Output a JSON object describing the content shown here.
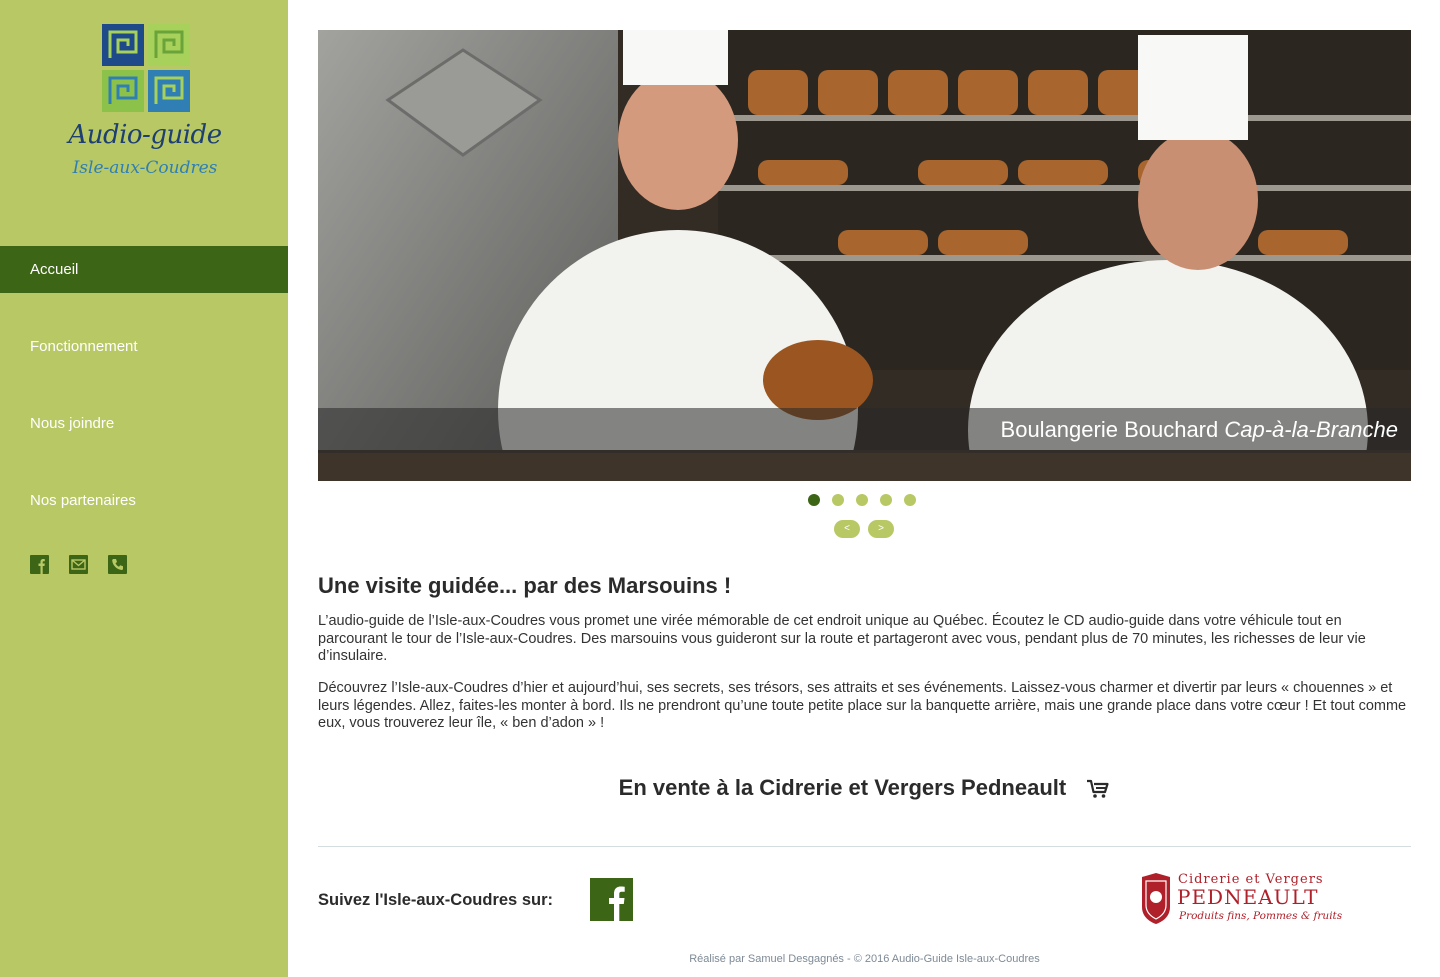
{
  "colors": {
    "sidebar_bg": "#b8c865",
    "nav_active_bg": "#3d6516",
    "accent_dark": "#3d6516",
    "logo_blue": "#1e3f72",
    "logo_light_blue": "#2f7fb5",
    "partner_red": "#b0202a"
  },
  "logo": {
    "title": "Audio-guide",
    "subtitle": "Isle-aux-Coudres"
  },
  "nav": {
    "items": [
      {
        "label": "Accueil",
        "active": true
      },
      {
        "label": "Fonctionnement",
        "active": false
      },
      {
        "label": "Nous joindre",
        "active": false
      },
      {
        "label": "Nos partenaires",
        "active": false
      }
    ]
  },
  "sidebar_social": {
    "icons": [
      "facebook-icon",
      "mail-icon",
      "phone-icon"
    ]
  },
  "slider": {
    "caption_main": "Boulangerie Bouchard ",
    "caption_italic": "Cap-à-la-Branche",
    "slide_count": 5,
    "active_slide": 1,
    "prev_label": "<",
    "next_label": ">"
  },
  "content": {
    "heading": "Une visite guidée... par des Marsouins !",
    "paragraph1": "L’audio-guide de l’Isle-aux-Coudres vous promet une virée mémorable de cet endroit unique au Québec. Écoutez le CD audio-guide dans votre véhicule tout en parcourant le tour de l’Isle-aux-Coudres. Des marsouins vous guideront sur la route et partageront avec vous, pendant plus de 70 minutes, les richesses de leur vie d’insulaire.",
    "paragraph2": "Découvrez l’Isle-aux-Coudres d’hier et aujourd’hui, ses secrets, ses trésors, ses attraits et ses événements. Laissez-vous charmer et divertir par leurs « chouennes » et leurs légendes. Allez, faites-les monter à bord. Ils ne prendront qu’une toute petite place sur la banquette arrière, mais une grande place dans votre cœur ! Et tout comme eux, vous trouverez leur île, « ben d’adon » !",
    "sale_text": "En vente à la Cidrerie et Vergers Pedneault"
  },
  "follow": {
    "label": "Suivez l'Isle-aux-Coudres sur:"
  },
  "partner": {
    "line1": "Cidrerie et Vergers",
    "name": "PEDNEAULT",
    "tagline": "Produits fins, Pommes & fruits"
  },
  "footer": {
    "text": "Réalisé par Samuel Desgagnés - © 2016 Audio-Guide Isle-aux-Coudres"
  }
}
